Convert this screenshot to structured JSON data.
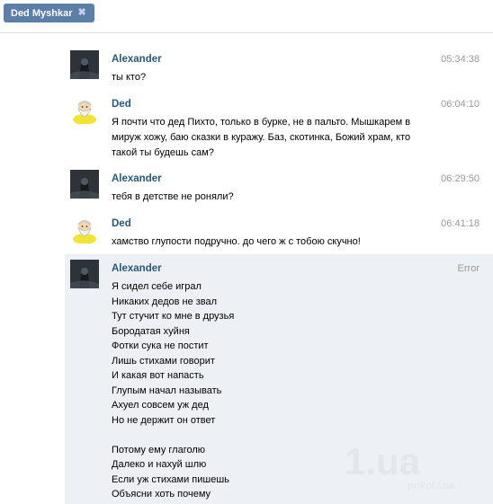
{
  "tab": {
    "title": "Ded Myshkar",
    "close_symbol": "✖"
  },
  "messages": [
    {
      "author": "Alexander",
      "time": "05:34:38",
      "avatar": "alexander-avatar",
      "lines": [
        "ты кто?"
      ]
    },
    {
      "author": "Ded",
      "time": "06:04:10",
      "avatar": "ded-avatar",
      "lines": [
        "Я почти что дед Пихто, только в бурке, не в пальто. Мышкарем в",
        "мируж хожу, баю сказки в куражу. Баз, скотинка, Божий храм, кто",
        "такой ты будешь сам?"
      ]
    },
    {
      "author": "Alexander",
      "time": "06:29:50",
      "avatar": "alexander-avatar",
      "lines": [
        "тебя в детстве не роняли?"
      ]
    },
    {
      "author": "Ded",
      "time": "06:41:18",
      "avatar": "ded-avatar",
      "lines": [
        "хамство глупости подручно. до чего ж с тобою скучно!"
      ]
    },
    {
      "author": "Alexander",
      "time": "Error",
      "avatar": "alexander-avatar",
      "lines": [
        "Я сидел себе играл",
        "Никаких дедов не звал",
        "Тут стучит ко мне в друзья",
        "Бородатая хуйня",
        "Фотки сука не постит",
        "Лишь стихами говорит",
        "И какая вот напасть",
        "Глупым начал называть",
        "Ахуел совсем уж дед",
        "Но не держит он ответ",
        "",
        "Потому ему глаголю",
        "Далеко и нахуй шлю",
        "Если уж стихами пишешь",
        "Объясни хоть почему"
      ]
    }
  ],
  "watermark": {
    "number": "1.ua",
    "site": "prikol.i.ua"
  },
  "colors": {
    "tab_bg": "#5b7fa6",
    "author": "#2b587a",
    "time": "#999999",
    "highlight_bg": "#edf1f5"
  }
}
